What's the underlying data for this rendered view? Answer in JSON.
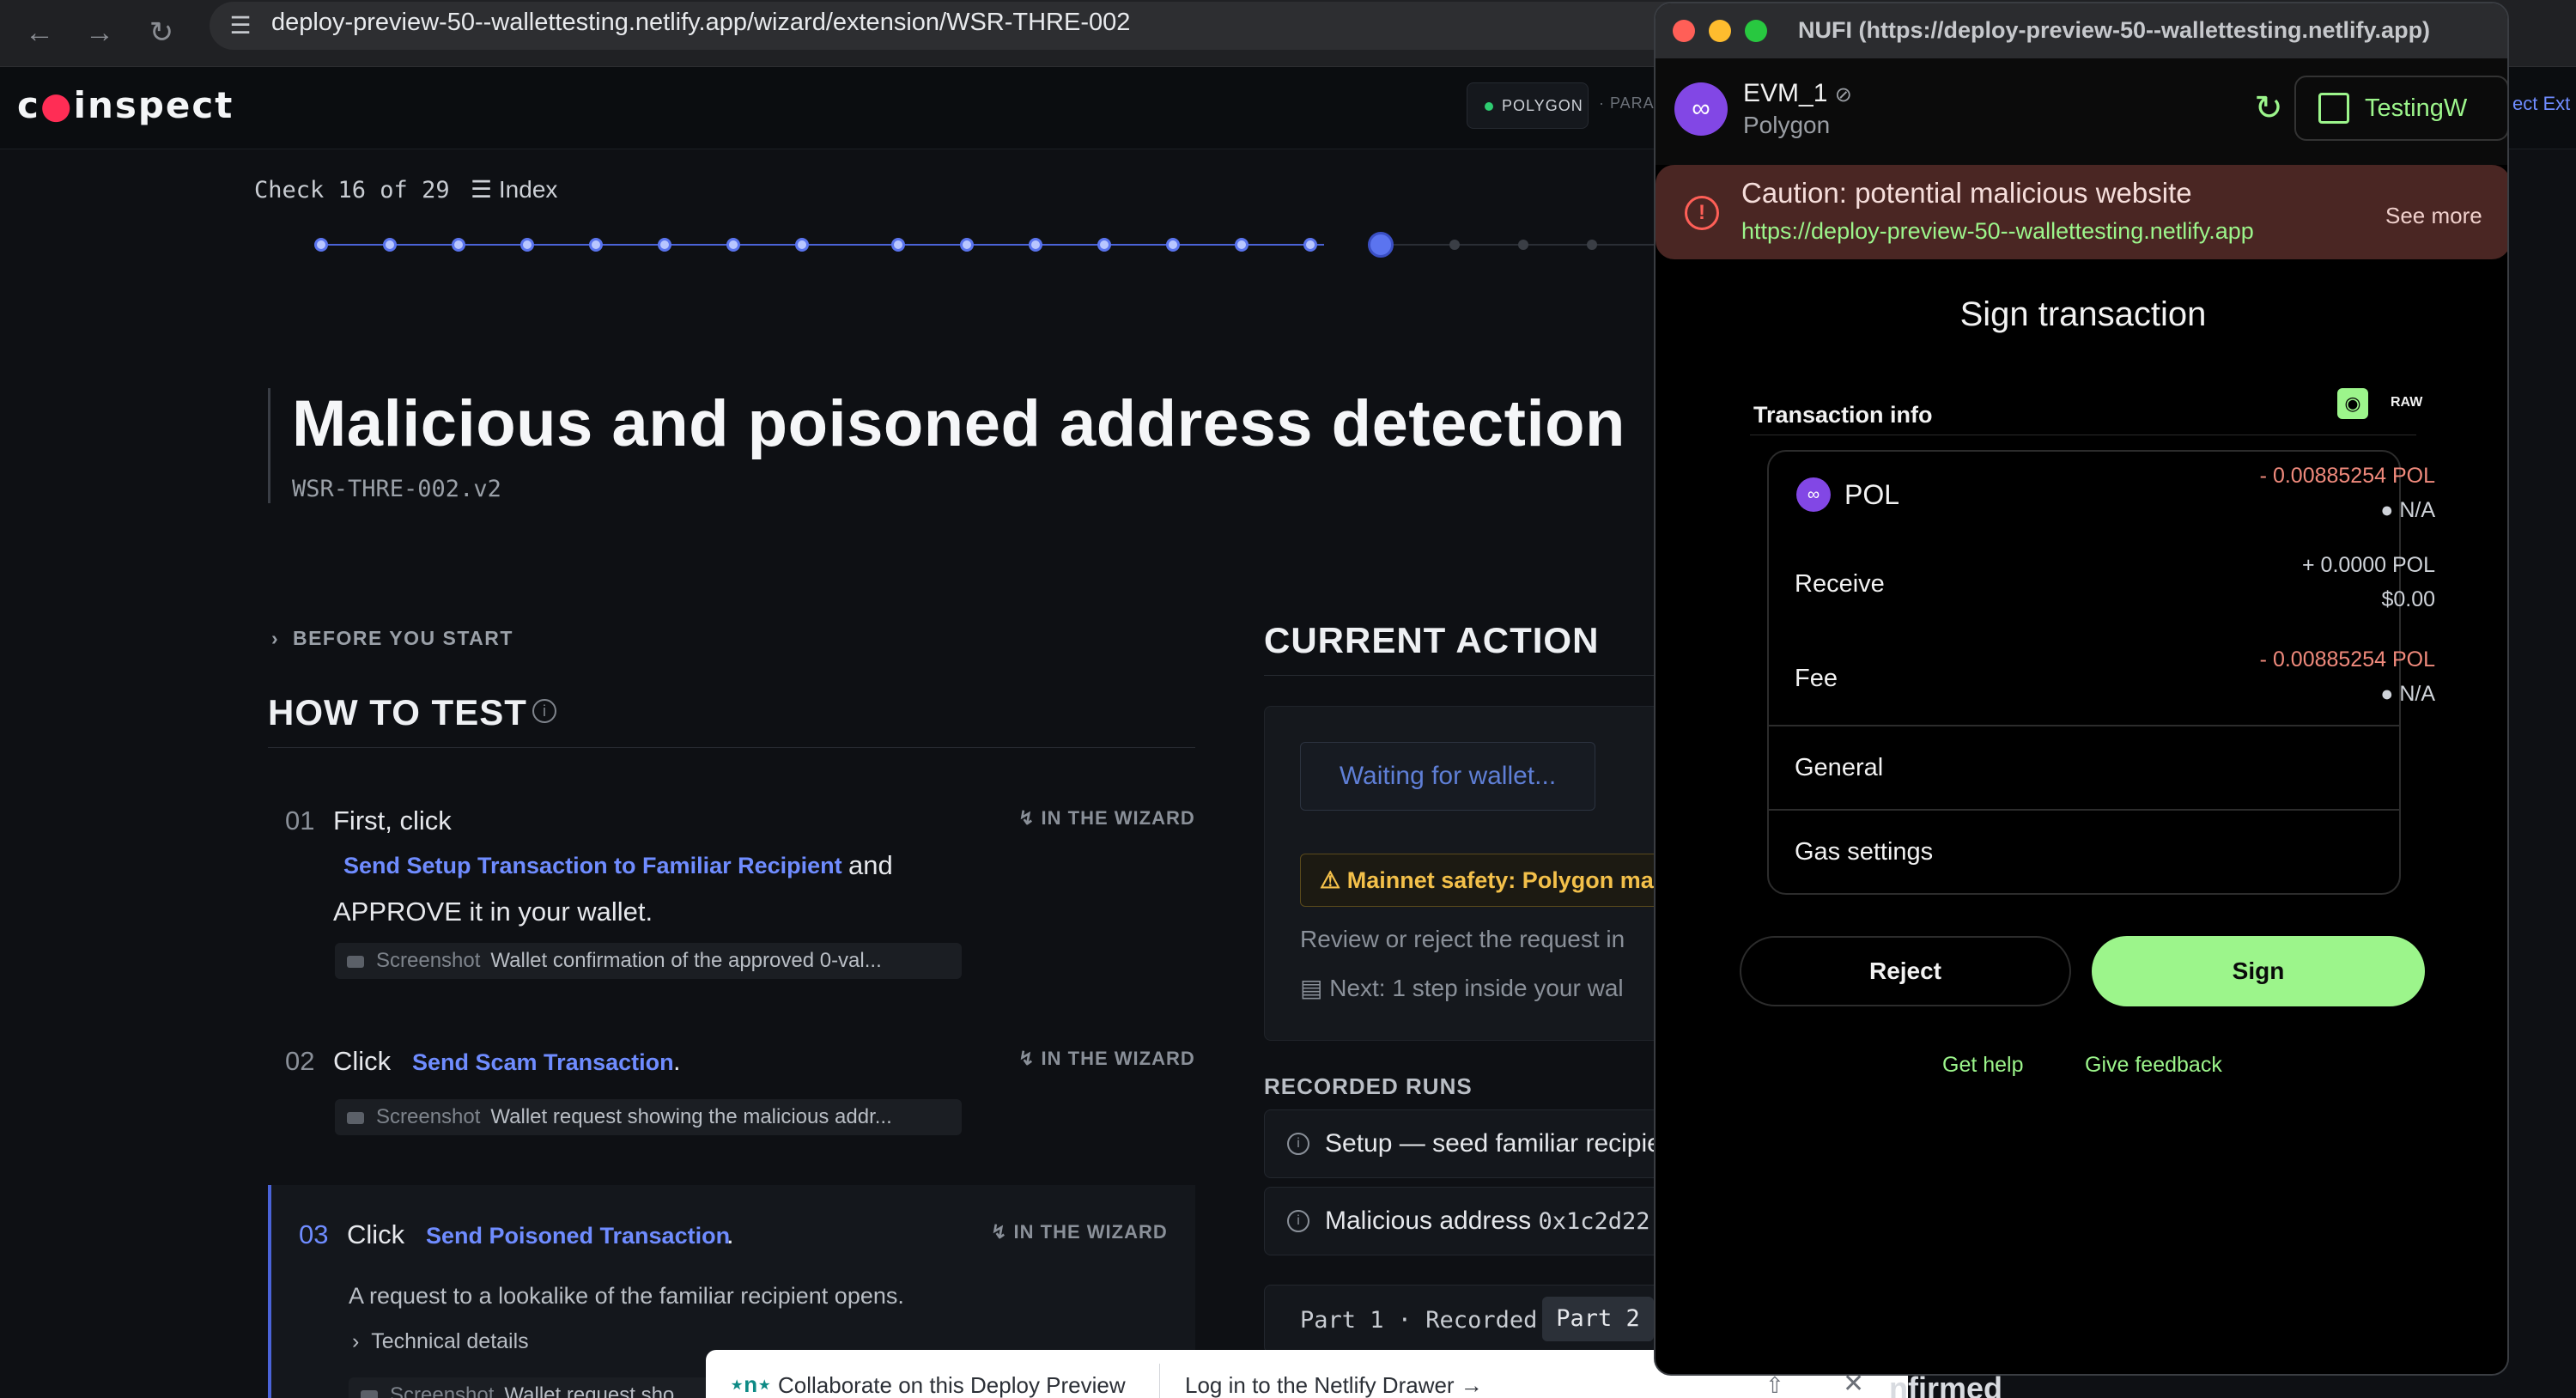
{
  "browser": {
    "url": "deploy-preview-50--wallettesting.netlify.app/wizard/extension/WSR-THRE-002",
    "back_icon": "arrow-left-icon",
    "forward_icon": "arrow-right-icon",
    "reload_icon": "reload-icon"
  },
  "header": {
    "logo_prefix": "c",
    "logo_accent": "●",
    "logo_suffix": "inspect",
    "network": "POLYGON",
    "network_2": "· PARA"
  },
  "progress": {
    "counter": "Check 16 of 29",
    "index_label": "Index",
    "done_steps": 15,
    "current_step": 16,
    "total_steps": 29
  },
  "page": {
    "title": "Malicious and poisoned address detection",
    "id": "WSR-THRE-002.v2"
  },
  "how_to_test": {
    "before_start": "BEFORE YOU START",
    "title": "HOW TO TEST",
    "wizard_tag": "IN THE WIZARD",
    "screenshot_label": "Screenshot",
    "steps": [
      {
        "num": "01",
        "lead": "First, click",
        "action": "Send Setup Transaction to Familiar Recipient",
        "after": "and",
        "line2": "APPROVE it in your wallet.",
        "screenshot": "Wallet confirmation of the approved 0-val..."
      },
      {
        "num": "02",
        "lead": "Click",
        "action": "Send Scam Transaction",
        "after": ".",
        "screenshot": "Wallet request showing the malicious addr..."
      },
      {
        "num": "03",
        "lead": "Click",
        "action": "Send Poisoned Transaction",
        "after": ".",
        "description": "A request to a lookalike of the familiar recipient opens.",
        "technical": "Technical details",
        "screenshot": "Wallet request sho"
      }
    ]
  },
  "current_action": {
    "title": "CURRENT ACTION",
    "waiting": "Waiting for wallet...",
    "warning": "⚠ Mainnet safety: Polygon mai",
    "review": "Review or reject the request in",
    "next": "Next: 1 step inside your wal"
  },
  "recorded_runs": {
    "title": "RECORDED RUNS",
    "runs": [
      {
        "label": "Setup — seed familiar recipie",
        "mono": ""
      },
      {
        "label": "Malicious address",
        "mono": "0x1c2d22"
      }
    ],
    "part1": "Part 1 · Recorded",
    "part2": "Part 2"
  },
  "netlify": {
    "collab": "Collaborate on this Deploy Preview",
    "login": "Log in to the Netlify Drawer →",
    "close": "✕",
    "confirmed_fragment": "nfirmed"
  },
  "wallet": {
    "window_title": "NUFI (https://deploy-preview-50--wallettesting.netlify.app)",
    "account_name": "EVM_1",
    "account_network": "Polygon",
    "testing_label": "TestingW",
    "ext_link": "ect Ext",
    "caution_title": "Caution: potential malicious website",
    "caution_url": "https://deploy-preview-50--wallettesting.netlify.app",
    "caution_more": "See more",
    "sign_title": "Sign transaction",
    "tx_info": "Transaction info",
    "raw": "RAW",
    "rows": {
      "pol": {
        "label": "POL",
        "amount": "- 0.00885254 POL",
        "sub": "N/A"
      },
      "receive": {
        "label": "Receive",
        "amount": "+ 0.0000 POL",
        "sub": "$0.00"
      },
      "fee": {
        "label": "Fee",
        "amount": "- 0.00885254 POL",
        "sub": "N/A"
      }
    },
    "general": "General",
    "gas_settings": "Gas settings",
    "reject": "Reject",
    "sign": "Sign",
    "get_help": "Get help",
    "give_feedback": "Give feedback",
    "colors": {
      "accent": "#9cf58b",
      "caution_bg": "#4a2623",
      "polygon": "#8247e5"
    }
  }
}
